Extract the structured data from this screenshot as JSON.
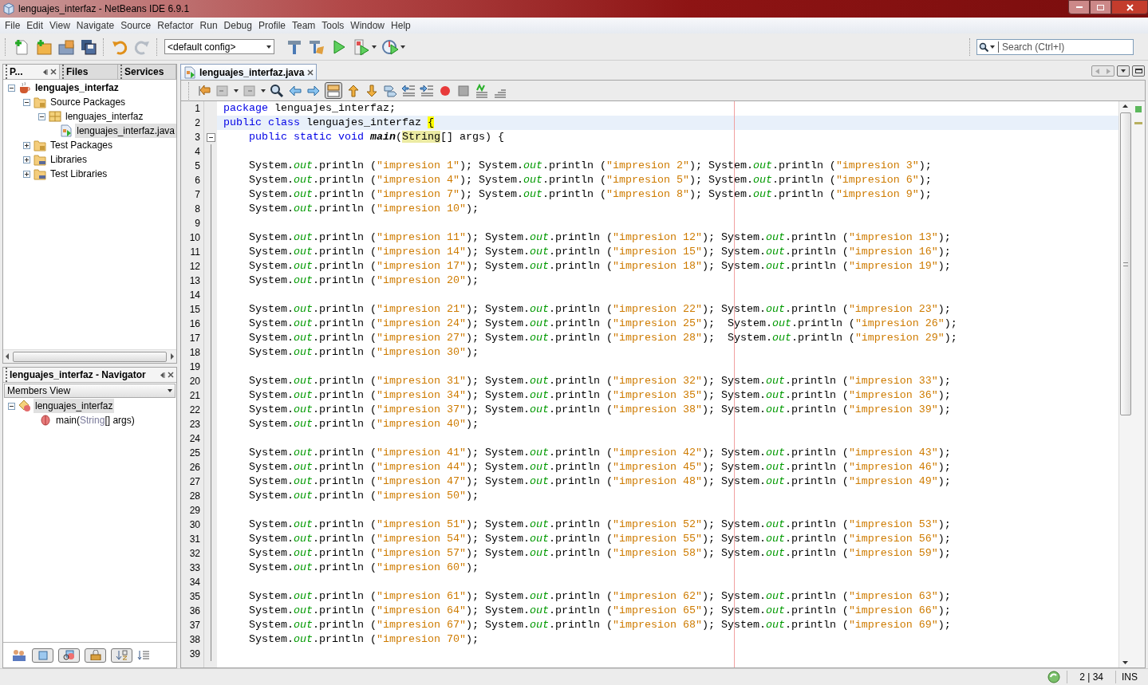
{
  "window": {
    "title": "lenguajes_interfaz - NetBeans IDE 6.9.1"
  },
  "menu": [
    "File",
    "Edit",
    "View",
    "Navigate",
    "Source",
    "Refactor",
    "Run",
    "Debug",
    "Profile",
    "Team",
    "Tools",
    "Window",
    "Help"
  ],
  "toolbar": {
    "config": "<default config>"
  },
  "search": {
    "placeholder": "Search (Ctrl+I)"
  },
  "projects_panel": {
    "tabs": [
      {
        "label": "P...",
        "selected": true
      },
      {
        "label": "Files",
        "selected": false
      },
      {
        "label": "Services",
        "selected": false
      }
    ],
    "tree": [
      {
        "label": "lenguajes_interfaz",
        "kind": "project",
        "expanded": true,
        "selected": false,
        "children": [
          {
            "label": "Source Packages",
            "kind": "source-folder",
            "expanded": true,
            "selected": false,
            "children": [
              {
                "label": "lenguajes_interfaz",
                "kind": "package",
                "expanded": true,
                "selected": false,
                "children": [
                  {
                    "label": "lenguajes_interfaz.java",
                    "kind": "java-file",
                    "selected": true
                  }
                ]
              }
            ]
          },
          {
            "label": "Test Packages",
            "kind": "source-folder",
            "expanded": false,
            "selected": false
          },
          {
            "label": "Libraries",
            "kind": "library",
            "expanded": false,
            "selected": false
          },
          {
            "label": "Test Libraries",
            "kind": "library",
            "expanded": false,
            "selected": false
          }
        ]
      }
    ]
  },
  "navigator": {
    "title": "lenguajes_interfaz - Navigator",
    "view": "Members View",
    "tree": [
      {
        "kind": "class",
        "expanded": true,
        "selected": true,
        "segments": [
          {
            "kind": "name",
            "text": "lenguajes_interfaz"
          }
        ],
        "children": [
          {
            "kind": "method",
            "selected": false,
            "segments": [
              {
                "kind": "name",
                "text": "main("
              },
              {
                "kind": "type",
                "text": "String"
              },
              {
                "kind": "name",
                "text": "[] args)"
              }
            ]
          }
        ]
      }
    ]
  },
  "editor": {
    "tab": {
      "label": "lenguajes_interfaz.java",
      "selected": true
    },
    "lines": [
      {
        "number": "1",
        "current": false,
        "segments": [
          {
            "kind": "keyword",
            "text": "package"
          },
          {
            "kind": "plain",
            "text": " lenguajes_interfaz;"
          }
        ]
      },
      {
        "number": "2",
        "current": true,
        "segments": [
          {
            "kind": "keyword",
            "text": "public class"
          },
          {
            "kind": "plain",
            "text": " lenguajes_interfaz "
          },
          {
            "kind": "brace",
            "text": "{"
          }
        ]
      },
      {
        "number": "3",
        "current": false,
        "foldable": true,
        "segments": [
          {
            "kind": "keyword",
            "text": "    public static void "
          },
          {
            "kind": "method",
            "text": "main"
          },
          {
            "kind": "plain",
            "text": "("
          },
          {
            "kind": "match",
            "text": "String"
          },
          {
            "kind": "plain",
            "text": "[] args) {"
          }
        ]
      },
      {
        "number": "4",
        "current": false
      },
      {
        "number": "5",
        "current": false,
        "segments": [
          {
            "kind": "plain",
            "text": "    System."
          },
          {
            "kind": "field",
            "text": "out"
          },
          {
            "kind": "plain",
            "text": ".println ("
          },
          {
            "kind": "string",
            "text": "\"impresion 1\""
          },
          {
            "kind": "plain",
            "text": "); System."
          },
          {
            "kind": "field",
            "text": "out"
          },
          {
            "kind": "plain",
            "text": ".println ("
          },
          {
            "kind": "string",
            "text": "\"impresion 2\""
          },
          {
            "kind": "plain",
            "text": "); System."
          },
          {
            "kind": "field",
            "text": "out"
          },
          {
            "kind": "plain",
            "text": ".println ("
          },
          {
            "kind": "string",
            "text": "\"impresion 3\""
          },
          {
            "kind": "plain",
            "text": ");"
          }
        ]
      },
      {
        "number": "6",
        "current": false,
        "segments": [
          {
            "kind": "plain",
            "text": "    System."
          },
          {
            "kind": "field",
            "text": "out"
          },
          {
            "kind": "plain",
            "text": ".println ("
          },
          {
            "kind": "string",
            "text": "\"impresion 4\""
          },
          {
            "kind": "plain",
            "text": "); System."
          },
          {
            "kind": "field",
            "text": "out"
          },
          {
            "kind": "plain",
            "text": ".println ("
          },
          {
            "kind": "string",
            "text": "\"impresion 5\""
          },
          {
            "kind": "plain",
            "text": "); System."
          },
          {
            "kind": "field",
            "text": "out"
          },
          {
            "kind": "plain",
            "text": ".println ("
          },
          {
            "kind": "string",
            "text": "\"impresion 6\""
          },
          {
            "kind": "plain",
            "text": ");"
          }
        ]
      },
      {
        "number": "7",
        "current": false,
        "segments": [
          {
            "kind": "plain",
            "text": "    System."
          },
          {
            "kind": "field",
            "text": "out"
          },
          {
            "kind": "plain",
            "text": ".println ("
          },
          {
            "kind": "string",
            "text": "\"impresion 7\""
          },
          {
            "kind": "plain",
            "text": "); System."
          },
          {
            "kind": "field",
            "text": "out"
          },
          {
            "kind": "plain",
            "text": ".println ("
          },
          {
            "kind": "string",
            "text": "\"impresion 8\""
          },
          {
            "kind": "plain",
            "text": "); System."
          },
          {
            "kind": "field",
            "text": "out"
          },
          {
            "kind": "plain",
            "text": ".println ("
          },
          {
            "kind": "string",
            "text": "\"impresion 9\""
          },
          {
            "kind": "plain",
            "text": ");"
          }
        ]
      },
      {
        "number": "8",
        "current": false,
        "segments": [
          {
            "kind": "plain",
            "text": "    System."
          },
          {
            "kind": "field",
            "text": "out"
          },
          {
            "kind": "plain",
            "text": ".println ("
          },
          {
            "kind": "string",
            "text": "\"impresion 10\""
          },
          {
            "kind": "plain",
            "text": ");"
          }
        ]
      },
      {
        "number": "9",
        "current": false
      },
      {
        "number": "10",
        "current": false,
        "segments": [
          {
            "kind": "plain",
            "text": "    System."
          },
          {
            "kind": "field",
            "text": "out"
          },
          {
            "kind": "plain",
            "text": ".println ("
          },
          {
            "kind": "string",
            "text": "\"impresion 11\""
          },
          {
            "kind": "plain",
            "text": "); System."
          },
          {
            "kind": "field",
            "text": "out"
          },
          {
            "kind": "plain",
            "text": ".println ("
          },
          {
            "kind": "string",
            "text": "\"impresion 12\""
          },
          {
            "kind": "plain",
            "text": "); System."
          },
          {
            "kind": "field",
            "text": "out"
          },
          {
            "kind": "plain",
            "text": ".println ("
          },
          {
            "kind": "string",
            "text": "\"impresion 13\""
          },
          {
            "kind": "plain",
            "text": ");"
          }
        ]
      },
      {
        "number": "11",
        "current": false,
        "segments": [
          {
            "kind": "plain",
            "text": "    System."
          },
          {
            "kind": "field",
            "text": "out"
          },
          {
            "kind": "plain",
            "text": ".println ("
          },
          {
            "kind": "string",
            "text": "\"impresion 14\""
          },
          {
            "kind": "plain",
            "text": "); System."
          },
          {
            "kind": "field",
            "text": "out"
          },
          {
            "kind": "plain",
            "text": ".println ("
          },
          {
            "kind": "string",
            "text": "\"impresion 15\""
          },
          {
            "kind": "plain",
            "text": "); System."
          },
          {
            "kind": "field",
            "text": "out"
          },
          {
            "kind": "plain",
            "text": ".println ("
          },
          {
            "kind": "string",
            "text": "\"impresion 16\""
          },
          {
            "kind": "plain",
            "text": ");"
          }
        ]
      },
      {
        "number": "12",
        "current": false,
        "segments": [
          {
            "kind": "plain",
            "text": "    System."
          },
          {
            "kind": "field",
            "text": "out"
          },
          {
            "kind": "plain",
            "text": ".println ("
          },
          {
            "kind": "string",
            "text": "\"impresion 17\""
          },
          {
            "kind": "plain",
            "text": "); System."
          },
          {
            "kind": "field",
            "text": "out"
          },
          {
            "kind": "plain",
            "text": ".println ("
          },
          {
            "kind": "string",
            "text": "\"impresion 18\""
          },
          {
            "kind": "plain",
            "text": "); System."
          },
          {
            "kind": "field",
            "text": "out"
          },
          {
            "kind": "plain",
            "text": ".println ("
          },
          {
            "kind": "string",
            "text": "\"impresion 19\""
          },
          {
            "kind": "plain",
            "text": ");"
          }
        ]
      },
      {
        "number": "13",
        "current": false,
        "segments": [
          {
            "kind": "plain",
            "text": "    System."
          },
          {
            "kind": "field",
            "text": "out"
          },
          {
            "kind": "plain",
            "text": ".println ("
          },
          {
            "kind": "string",
            "text": "\"impresion 20\""
          },
          {
            "kind": "plain",
            "text": ");"
          }
        ]
      },
      {
        "number": "14",
        "current": false
      },
      {
        "number": "15",
        "current": false,
        "segments": [
          {
            "kind": "plain",
            "text": "    System."
          },
          {
            "kind": "field",
            "text": "out"
          },
          {
            "kind": "plain",
            "text": ".println ("
          },
          {
            "kind": "string",
            "text": "\"impresion 21\""
          },
          {
            "kind": "plain",
            "text": "); System."
          },
          {
            "kind": "field",
            "text": "out"
          },
          {
            "kind": "plain",
            "text": ".println ("
          },
          {
            "kind": "string",
            "text": "\"impresion 22\""
          },
          {
            "kind": "plain",
            "text": "); System."
          },
          {
            "kind": "field",
            "text": "out"
          },
          {
            "kind": "plain",
            "text": ".println ("
          },
          {
            "kind": "string",
            "text": "\"impresion 23\""
          },
          {
            "kind": "plain",
            "text": ");"
          }
        ]
      },
      {
        "number": "16",
        "current": false,
        "segments": [
          {
            "kind": "plain",
            "text": "    System."
          },
          {
            "kind": "field",
            "text": "out"
          },
          {
            "kind": "plain",
            "text": ".println ("
          },
          {
            "kind": "string",
            "text": "\"impresion 24\""
          },
          {
            "kind": "plain",
            "text": "); System."
          },
          {
            "kind": "field",
            "text": "out"
          },
          {
            "kind": "plain",
            "text": ".println ("
          },
          {
            "kind": "string",
            "text": "\"impresion 25\""
          },
          {
            "kind": "plain",
            "text": ");  System."
          },
          {
            "kind": "field",
            "text": "out"
          },
          {
            "kind": "plain",
            "text": ".println ("
          },
          {
            "kind": "string",
            "text": "\"impresion 26\""
          },
          {
            "kind": "plain",
            "text": ");"
          }
        ]
      },
      {
        "number": "17",
        "current": false,
        "segments": [
          {
            "kind": "plain",
            "text": "    System."
          },
          {
            "kind": "field",
            "text": "out"
          },
          {
            "kind": "plain",
            "text": ".println ("
          },
          {
            "kind": "string",
            "text": "\"impresion 27\""
          },
          {
            "kind": "plain",
            "text": "); System."
          },
          {
            "kind": "field",
            "text": "out"
          },
          {
            "kind": "plain",
            "text": ".println ("
          },
          {
            "kind": "string",
            "text": "\"impresion 28\""
          },
          {
            "kind": "plain",
            "text": ");  System."
          },
          {
            "kind": "field",
            "text": "out"
          },
          {
            "kind": "plain",
            "text": ".println ("
          },
          {
            "kind": "string",
            "text": "\"impresion 29\""
          },
          {
            "kind": "plain",
            "text": ");"
          }
        ]
      },
      {
        "number": "18",
        "current": false,
        "segments": [
          {
            "kind": "plain",
            "text": "    System."
          },
          {
            "kind": "field",
            "text": "out"
          },
          {
            "kind": "plain",
            "text": ".println ("
          },
          {
            "kind": "string",
            "text": "\"impresion 30\""
          },
          {
            "kind": "plain",
            "text": ");"
          }
        ]
      },
      {
        "number": "19",
        "current": false
      },
      {
        "number": "20",
        "current": false,
        "segments": [
          {
            "kind": "plain",
            "text": "    System."
          },
          {
            "kind": "field",
            "text": "out"
          },
          {
            "kind": "plain",
            "text": ".println ("
          },
          {
            "kind": "string",
            "text": "\"impresion 31\""
          },
          {
            "kind": "plain",
            "text": "); System."
          },
          {
            "kind": "field",
            "text": "out"
          },
          {
            "kind": "plain",
            "text": ".println ("
          },
          {
            "kind": "string",
            "text": "\"impresion 32\""
          },
          {
            "kind": "plain",
            "text": "); System."
          },
          {
            "kind": "field",
            "text": "out"
          },
          {
            "kind": "plain",
            "text": ".println ("
          },
          {
            "kind": "string",
            "text": "\"impresion 33\""
          },
          {
            "kind": "plain",
            "text": ");"
          }
        ]
      },
      {
        "number": "21",
        "current": false,
        "segments": [
          {
            "kind": "plain",
            "text": "    System."
          },
          {
            "kind": "field",
            "text": "out"
          },
          {
            "kind": "plain",
            "text": ".println ("
          },
          {
            "kind": "string",
            "text": "\"impresion 34\""
          },
          {
            "kind": "plain",
            "text": "); System."
          },
          {
            "kind": "field",
            "text": "out"
          },
          {
            "kind": "plain",
            "text": ".println ("
          },
          {
            "kind": "string",
            "text": "\"impresion 35\""
          },
          {
            "kind": "plain",
            "text": "); System."
          },
          {
            "kind": "field",
            "text": "out"
          },
          {
            "kind": "plain",
            "text": ".println ("
          },
          {
            "kind": "string",
            "text": "\"impresion 36\""
          },
          {
            "kind": "plain",
            "text": ");"
          }
        ]
      },
      {
        "number": "22",
        "current": false,
        "segments": [
          {
            "kind": "plain",
            "text": "    System."
          },
          {
            "kind": "field",
            "text": "out"
          },
          {
            "kind": "plain",
            "text": ".println ("
          },
          {
            "kind": "string",
            "text": "\"impresion 37\""
          },
          {
            "kind": "plain",
            "text": "); System."
          },
          {
            "kind": "field",
            "text": "out"
          },
          {
            "kind": "plain",
            "text": ".println ("
          },
          {
            "kind": "string",
            "text": "\"impresion 38\""
          },
          {
            "kind": "plain",
            "text": "); System."
          },
          {
            "kind": "field",
            "text": "out"
          },
          {
            "kind": "plain",
            "text": ".println ("
          },
          {
            "kind": "string",
            "text": "\"impresion 39\""
          },
          {
            "kind": "plain",
            "text": ");"
          }
        ]
      },
      {
        "number": "23",
        "current": false,
        "segments": [
          {
            "kind": "plain",
            "text": "    System."
          },
          {
            "kind": "field",
            "text": "out"
          },
          {
            "kind": "plain",
            "text": ".println ("
          },
          {
            "kind": "string",
            "text": "\"impresion 40\""
          },
          {
            "kind": "plain",
            "text": ");"
          }
        ]
      },
      {
        "number": "24",
        "current": false
      },
      {
        "number": "25",
        "current": false,
        "segments": [
          {
            "kind": "plain",
            "text": "    System."
          },
          {
            "kind": "field",
            "text": "out"
          },
          {
            "kind": "plain",
            "text": ".println ("
          },
          {
            "kind": "string",
            "text": "\"impresion 41\""
          },
          {
            "kind": "plain",
            "text": "); System."
          },
          {
            "kind": "field",
            "text": "out"
          },
          {
            "kind": "plain",
            "text": ".println ("
          },
          {
            "kind": "string",
            "text": "\"impresion 42\""
          },
          {
            "kind": "plain",
            "text": "); System."
          },
          {
            "kind": "field",
            "text": "out"
          },
          {
            "kind": "plain",
            "text": ".println ("
          },
          {
            "kind": "string",
            "text": "\"impresion 43\""
          },
          {
            "kind": "plain",
            "text": ");"
          }
        ]
      },
      {
        "number": "26",
        "current": false,
        "segments": [
          {
            "kind": "plain",
            "text": "    System."
          },
          {
            "kind": "field",
            "text": "out"
          },
          {
            "kind": "plain",
            "text": ".println ("
          },
          {
            "kind": "string",
            "text": "\"impresion 44\""
          },
          {
            "kind": "plain",
            "text": "); System."
          },
          {
            "kind": "field",
            "text": "out"
          },
          {
            "kind": "plain",
            "text": ".println ("
          },
          {
            "kind": "string",
            "text": "\"impresion 45\""
          },
          {
            "kind": "plain",
            "text": "); System."
          },
          {
            "kind": "field",
            "text": "out"
          },
          {
            "kind": "plain",
            "text": ".println ("
          },
          {
            "kind": "string",
            "text": "\"impresion 46\""
          },
          {
            "kind": "plain",
            "text": ");"
          }
        ]
      },
      {
        "number": "27",
        "current": false,
        "segments": [
          {
            "kind": "plain",
            "text": "    System."
          },
          {
            "kind": "field",
            "text": "out"
          },
          {
            "kind": "plain",
            "text": ".println ("
          },
          {
            "kind": "string",
            "text": "\"impresion 47\""
          },
          {
            "kind": "plain",
            "text": "); System."
          },
          {
            "kind": "field",
            "text": "out"
          },
          {
            "kind": "plain",
            "text": ".println ("
          },
          {
            "kind": "string",
            "text": "\"impresion 48\""
          },
          {
            "kind": "plain",
            "text": "); System."
          },
          {
            "kind": "field",
            "text": "out"
          },
          {
            "kind": "plain",
            "text": ".println ("
          },
          {
            "kind": "string",
            "text": "\"impresion 49\""
          },
          {
            "kind": "plain",
            "text": ");"
          }
        ]
      },
      {
        "number": "28",
        "current": false,
        "segments": [
          {
            "kind": "plain",
            "text": "    System."
          },
          {
            "kind": "field",
            "text": "out"
          },
          {
            "kind": "plain",
            "text": ".println ("
          },
          {
            "kind": "string",
            "text": "\"impresion 50\""
          },
          {
            "kind": "plain",
            "text": ");"
          }
        ]
      },
      {
        "number": "29",
        "current": false
      },
      {
        "number": "30",
        "current": false,
        "segments": [
          {
            "kind": "plain",
            "text": "    System."
          },
          {
            "kind": "field",
            "text": "out"
          },
          {
            "kind": "plain",
            "text": ".println ("
          },
          {
            "kind": "string",
            "text": "\"impresion 51\""
          },
          {
            "kind": "plain",
            "text": "); System."
          },
          {
            "kind": "field",
            "text": "out"
          },
          {
            "kind": "plain",
            "text": ".println ("
          },
          {
            "kind": "string",
            "text": "\"impresion 52\""
          },
          {
            "kind": "plain",
            "text": "); System."
          },
          {
            "kind": "field",
            "text": "out"
          },
          {
            "kind": "plain",
            "text": ".println ("
          },
          {
            "kind": "string",
            "text": "\"impresion 53\""
          },
          {
            "kind": "plain",
            "text": ");"
          }
        ]
      },
      {
        "number": "31",
        "current": false,
        "segments": [
          {
            "kind": "plain",
            "text": "    System."
          },
          {
            "kind": "field",
            "text": "out"
          },
          {
            "kind": "plain",
            "text": ".println ("
          },
          {
            "kind": "string",
            "text": "\"impresion 54\""
          },
          {
            "kind": "plain",
            "text": "); System."
          },
          {
            "kind": "field",
            "text": "out"
          },
          {
            "kind": "plain",
            "text": ".println ("
          },
          {
            "kind": "string",
            "text": "\"impresion 55\""
          },
          {
            "kind": "plain",
            "text": "); System."
          },
          {
            "kind": "field",
            "text": "out"
          },
          {
            "kind": "plain",
            "text": ".println ("
          },
          {
            "kind": "string",
            "text": "\"impresion 56\""
          },
          {
            "kind": "plain",
            "text": ");"
          }
        ]
      },
      {
        "number": "32",
        "current": false,
        "segments": [
          {
            "kind": "plain",
            "text": "    System."
          },
          {
            "kind": "field",
            "text": "out"
          },
          {
            "kind": "plain",
            "text": ".println ("
          },
          {
            "kind": "string",
            "text": "\"impresion 57\""
          },
          {
            "kind": "plain",
            "text": "); System."
          },
          {
            "kind": "field",
            "text": "out"
          },
          {
            "kind": "plain",
            "text": ".println ("
          },
          {
            "kind": "string",
            "text": "\"impresion 58\""
          },
          {
            "kind": "plain",
            "text": "); System."
          },
          {
            "kind": "field",
            "text": "out"
          },
          {
            "kind": "plain",
            "text": ".println ("
          },
          {
            "kind": "string",
            "text": "\"impresion 59\""
          },
          {
            "kind": "plain",
            "text": ");"
          }
        ]
      },
      {
        "number": "33",
        "current": false,
        "segments": [
          {
            "kind": "plain",
            "text": "    System."
          },
          {
            "kind": "field",
            "text": "out"
          },
          {
            "kind": "plain",
            "text": ".println ("
          },
          {
            "kind": "string",
            "text": "\"impresion 60\""
          },
          {
            "kind": "plain",
            "text": ");"
          }
        ]
      },
      {
        "number": "34",
        "current": false
      },
      {
        "number": "35",
        "current": false,
        "segments": [
          {
            "kind": "plain",
            "text": "    System."
          },
          {
            "kind": "field",
            "text": "out"
          },
          {
            "kind": "plain",
            "text": ".println ("
          },
          {
            "kind": "string",
            "text": "\"impresion 61\""
          },
          {
            "kind": "plain",
            "text": "); System."
          },
          {
            "kind": "field",
            "text": "out"
          },
          {
            "kind": "plain",
            "text": ".println ("
          },
          {
            "kind": "string",
            "text": "\"impresion 62\""
          },
          {
            "kind": "plain",
            "text": "); System."
          },
          {
            "kind": "field",
            "text": "out"
          },
          {
            "kind": "plain",
            "text": ".println ("
          },
          {
            "kind": "string",
            "text": "\"impresion 63\""
          },
          {
            "kind": "plain",
            "text": ");"
          }
        ]
      },
      {
        "number": "36",
        "current": false,
        "segments": [
          {
            "kind": "plain",
            "text": "    System."
          },
          {
            "kind": "field",
            "text": "out"
          },
          {
            "kind": "plain",
            "text": ".println ("
          },
          {
            "kind": "string",
            "text": "\"impresion 64\""
          },
          {
            "kind": "plain",
            "text": "); System."
          },
          {
            "kind": "field",
            "text": "out"
          },
          {
            "kind": "plain",
            "text": ".println ("
          },
          {
            "kind": "string",
            "text": "\"impresion 65\""
          },
          {
            "kind": "plain",
            "text": "); System."
          },
          {
            "kind": "field",
            "text": "out"
          },
          {
            "kind": "plain",
            "text": ".println ("
          },
          {
            "kind": "string",
            "text": "\"impresion 66\""
          },
          {
            "kind": "plain",
            "text": ");"
          }
        ]
      },
      {
        "number": "37",
        "current": false,
        "segments": [
          {
            "kind": "plain",
            "text": "    System."
          },
          {
            "kind": "field",
            "text": "out"
          },
          {
            "kind": "plain",
            "text": ".println ("
          },
          {
            "kind": "string",
            "text": "\"impresion 67\""
          },
          {
            "kind": "plain",
            "text": "); System."
          },
          {
            "kind": "field",
            "text": "out"
          },
          {
            "kind": "plain",
            "text": ".println ("
          },
          {
            "kind": "string",
            "text": "\"impresion 68\""
          },
          {
            "kind": "plain",
            "text": "); System."
          },
          {
            "kind": "field",
            "text": "out"
          },
          {
            "kind": "plain",
            "text": ".println ("
          },
          {
            "kind": "string",
            "text": "\"impresion 69\""
          },
          {
            "kind": "plain",
            "text": ");"
          }
        ]
      },
      {
        "number": "38",
        "current": false,
        "segments": [
          {
            "kind": "plain",
            "text": "    System."
          },
          {
            "kind": "field",
            "text": "out"
          },
          {
            "kind": "plain",
            "text": ".println ("
          },
          {
            "kind": "string",
            "text": "\"impresion 70\""
          },
          {
            "kind": "plain",
            "text": ");"
          }
        ]
      },
      {
        "number": "39",
        "current": false
      }
    ]
  },
  "status_bar": {
    "position": "2 | 34",
    "mode": "INS"
  }
}
